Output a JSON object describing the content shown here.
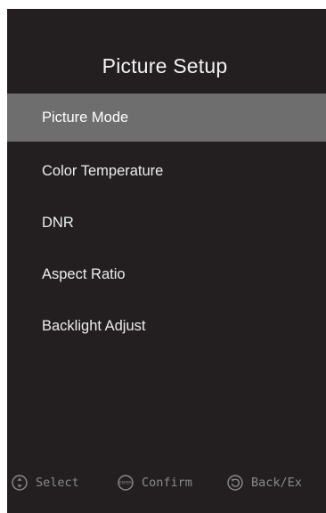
{
  "window": {
    "title": "Picture Setup"
  },
  "menu": {
    "items": [
      {
        "label": "Picture Mode",
        "selected": true
      },
      {
        "label": "Color Temperature",
        "selected": false
      },
      {
        "label": "DNR",
        "selected": false
      },
      {
        "label": "Aspect Ratio",
        "selected": false
      },
      {
        "label": "Backlight Adjust",
        "selected": false
      }
    ]
  },
  "footer": {
    "select": {
      "label": "Select",
      "icon": "up-down-arrows-icon"
    },
    "confirm": {
      "label": "Confirm",
      "icon": "enter-button-icon",
      "icon_text": "ENTER"
    },
    "back": {
      "label": "Back/Ex",
      "icon": "back-arrow-icon"
    }
  },
  "colors": {
    "background": "#231f20",
    "highlight": "#6e6e6e",
    "text": "#ededed",
    "hint_text": "#8a8a8a"
  }
}
